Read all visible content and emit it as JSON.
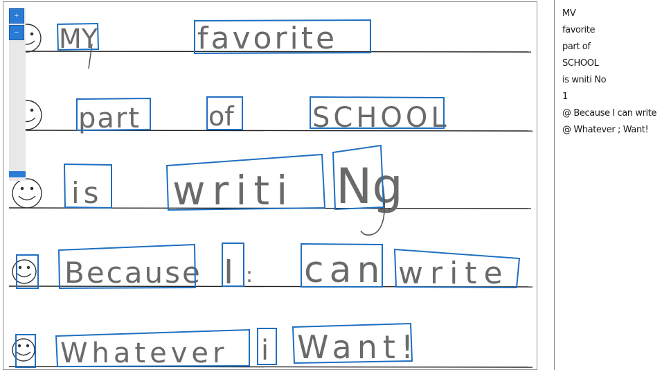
{
  "viewer": {
    "zoom_in_label": "+",
    "zoom_out_label": "−",
    "box_color": "#1f6fc0"
  },
  "handwriting": {
    "line1": [
      "MY",
      "favorite"
    ],
    "line2": [
      "part",
      "of",
      "SCHOOL"
    ],
    "line3": [
      "is",
      "writi",
      "Ng"
    ],
    "line4": [
      "Because",
      "I",
      ":",
      "can",
      "write"
    ],
    "line5": [
      "Whatever",
      "i",
      "Want!"
    ]
  },
  "transcription": {
    "lines": [
      "MV",
      "favorite",
      "part of",
      "SCHOOL",
      "is wniti No",
      "1",
      "@ Because I can write",
      "@ Whatever ; Want!"
    ]
  }
}
